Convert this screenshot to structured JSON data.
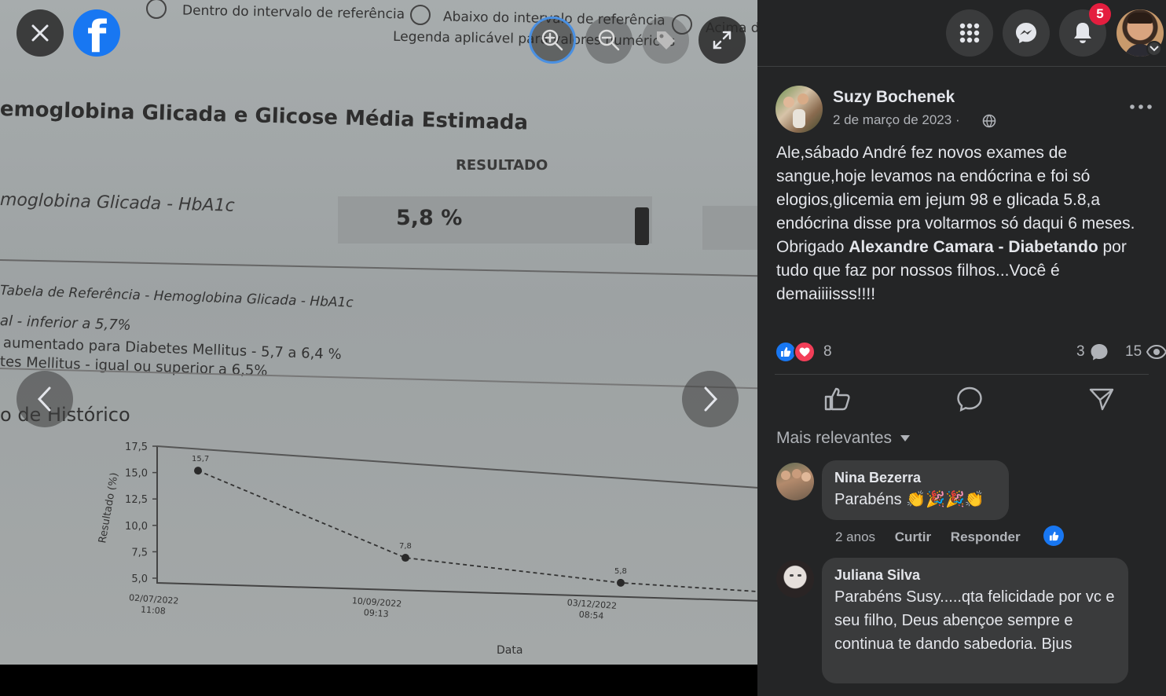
{
  "photo": {
    "legend_within": "Dentro do intervalo de referência",
    "legend_below": "Abaixo do intervalo de referência",
    "legend_above": "Acima d",
    "legend_note": "Legenda aplicável para valores numéricos",
    "section_title": "emoglobina Glicada e Glicose Média Estimada",
    "resultado_label": "RESULTADO",
    "exam_name": "moglobina Glicada - HbA1c",
    "exam_value": "5,8 %",
    "ref_table_title": "Tabela de Referência - Hemoglobina Glicada - HbA1c",
    "ref_line1": "al - inferior a 5,7%",
    "ref_line2": "aumentado para Diabetes Mellitus - 5,7 a 6,4 %",
    "ref_line3": "tes Mellitus - igual ou superior a 6,5%",
    "history_title": "o de Histórico",
    "chart_ylabel": "Resultado (%)",
    "chart_xlabel": "Data",
    "chart_yticks": [
      "17,5",
      "15,0",
      "12,5",
      "10,0",
      "7,5",
      "5,0"
    ],
    "chart_dates": [
      {
        "date": "02/07/2022",
        "time": "11:08"
      },
      {
        "date": "10/09/2022",
        "time": "09:13"
      },
      {
        "date": "03/12/2022",
        "time": "08:54"
      }
    ],
    "chart_point_labels": [
      "15,7",
      "7,8",
      "5,8"
    ]
  },
  "chart_data": {
    "type": "line",
    "x": [
      "02/07/2022 11:08",
      "10/09/2022 09:13",
      "03/12/2022 08:54"
    ],
    "series": [
      {
        "values": [
          15.7,
          7.8,
          5.8
        ]
      }
    ],
    "xlabel": "Data",
    "ylabel": "Resultado (%)",
    "ylim": [
      5.0,
      17.5
    ],
    "yticks": [
      "5,0",
      "7,5",
      "10,0",
      "12,5",
      "15,0",
      "17,5"
    ]
  },
  "viewer": {
    "close_icon": "close-icon",
    "brand_icon": "facebook-logo-icon",
    "zoom_in_icon": "zoom-in-icon",
    "zoom_out_icon": "zoom-out-icon",
    "tag_icon": "tag-icon",
    "fullscreen_icon": "fullscreen-icon",
    "prev_icon": "chevron-left-icon",
    "next_icon": "chevron-right-icon"
  },
  "topbar": {
    "menu_icon": "grid-menu-icon",
    "messenger_icon": "messenger-icon",
    "notifications_icon": "bell-icon",
    "notifications_count": "5",
    "account_icon": "chevron-down-icon"
  },
  "post": {
    "author": "Suzy Bochenek",
    "date": "2 de março de 2023",
    "privacy_sep": "·",
    "more_icon": "more-options-icon",
    "text_part1": "Ale,sábado André fez novos exames de sangue,hoje levamos na endócrina e foi só elogios,glicemia em jejum 98 e glicada 5.8,a endócrina disse pra voltarmos só daqui 6 meses. Obrigado ",
    "text_mention": "Alexandre Camara - Diabetando",
    "text_part2": " por tudo que faz por nossos filhos...Você é demaiiiisss!!!!",
    "reactions_count": "8",
    "comments_count": "3",
    "views_count": "15"
  },
  "actions": {
    "like_icon": "like-icon",
    "comment_icon": "comment-icon",
    "share_icon": "share-icon"
  },
  "comments_filter": "Mais relevantes",
  "comments": [
    {
      "author": "Nina Bezerra",
      "text": "Parabéns 👏🎉🎉👏",
      "time": "2 anos",
      "like_label": "Curtir",
      "reply_label": "Responder"
    },
    {
      "author": "Juliana Silva",
      "text": "Parabéns Susy.....qta felicidade por vc e seu filho, Deus abençoe sempre e continua te dando sabedoria. Bjus"
    }
  ],
  "colors": {
    "panel_bg": "#242526",
    "bubble_bg": "#3a3b3c",
    "facebook_blue": "#1877f2",
    "badge_red": "#e41e3f",
    "text_primary": "#e4e6eb",
    "text_secondary": "#b0b3b8"
  }
}
